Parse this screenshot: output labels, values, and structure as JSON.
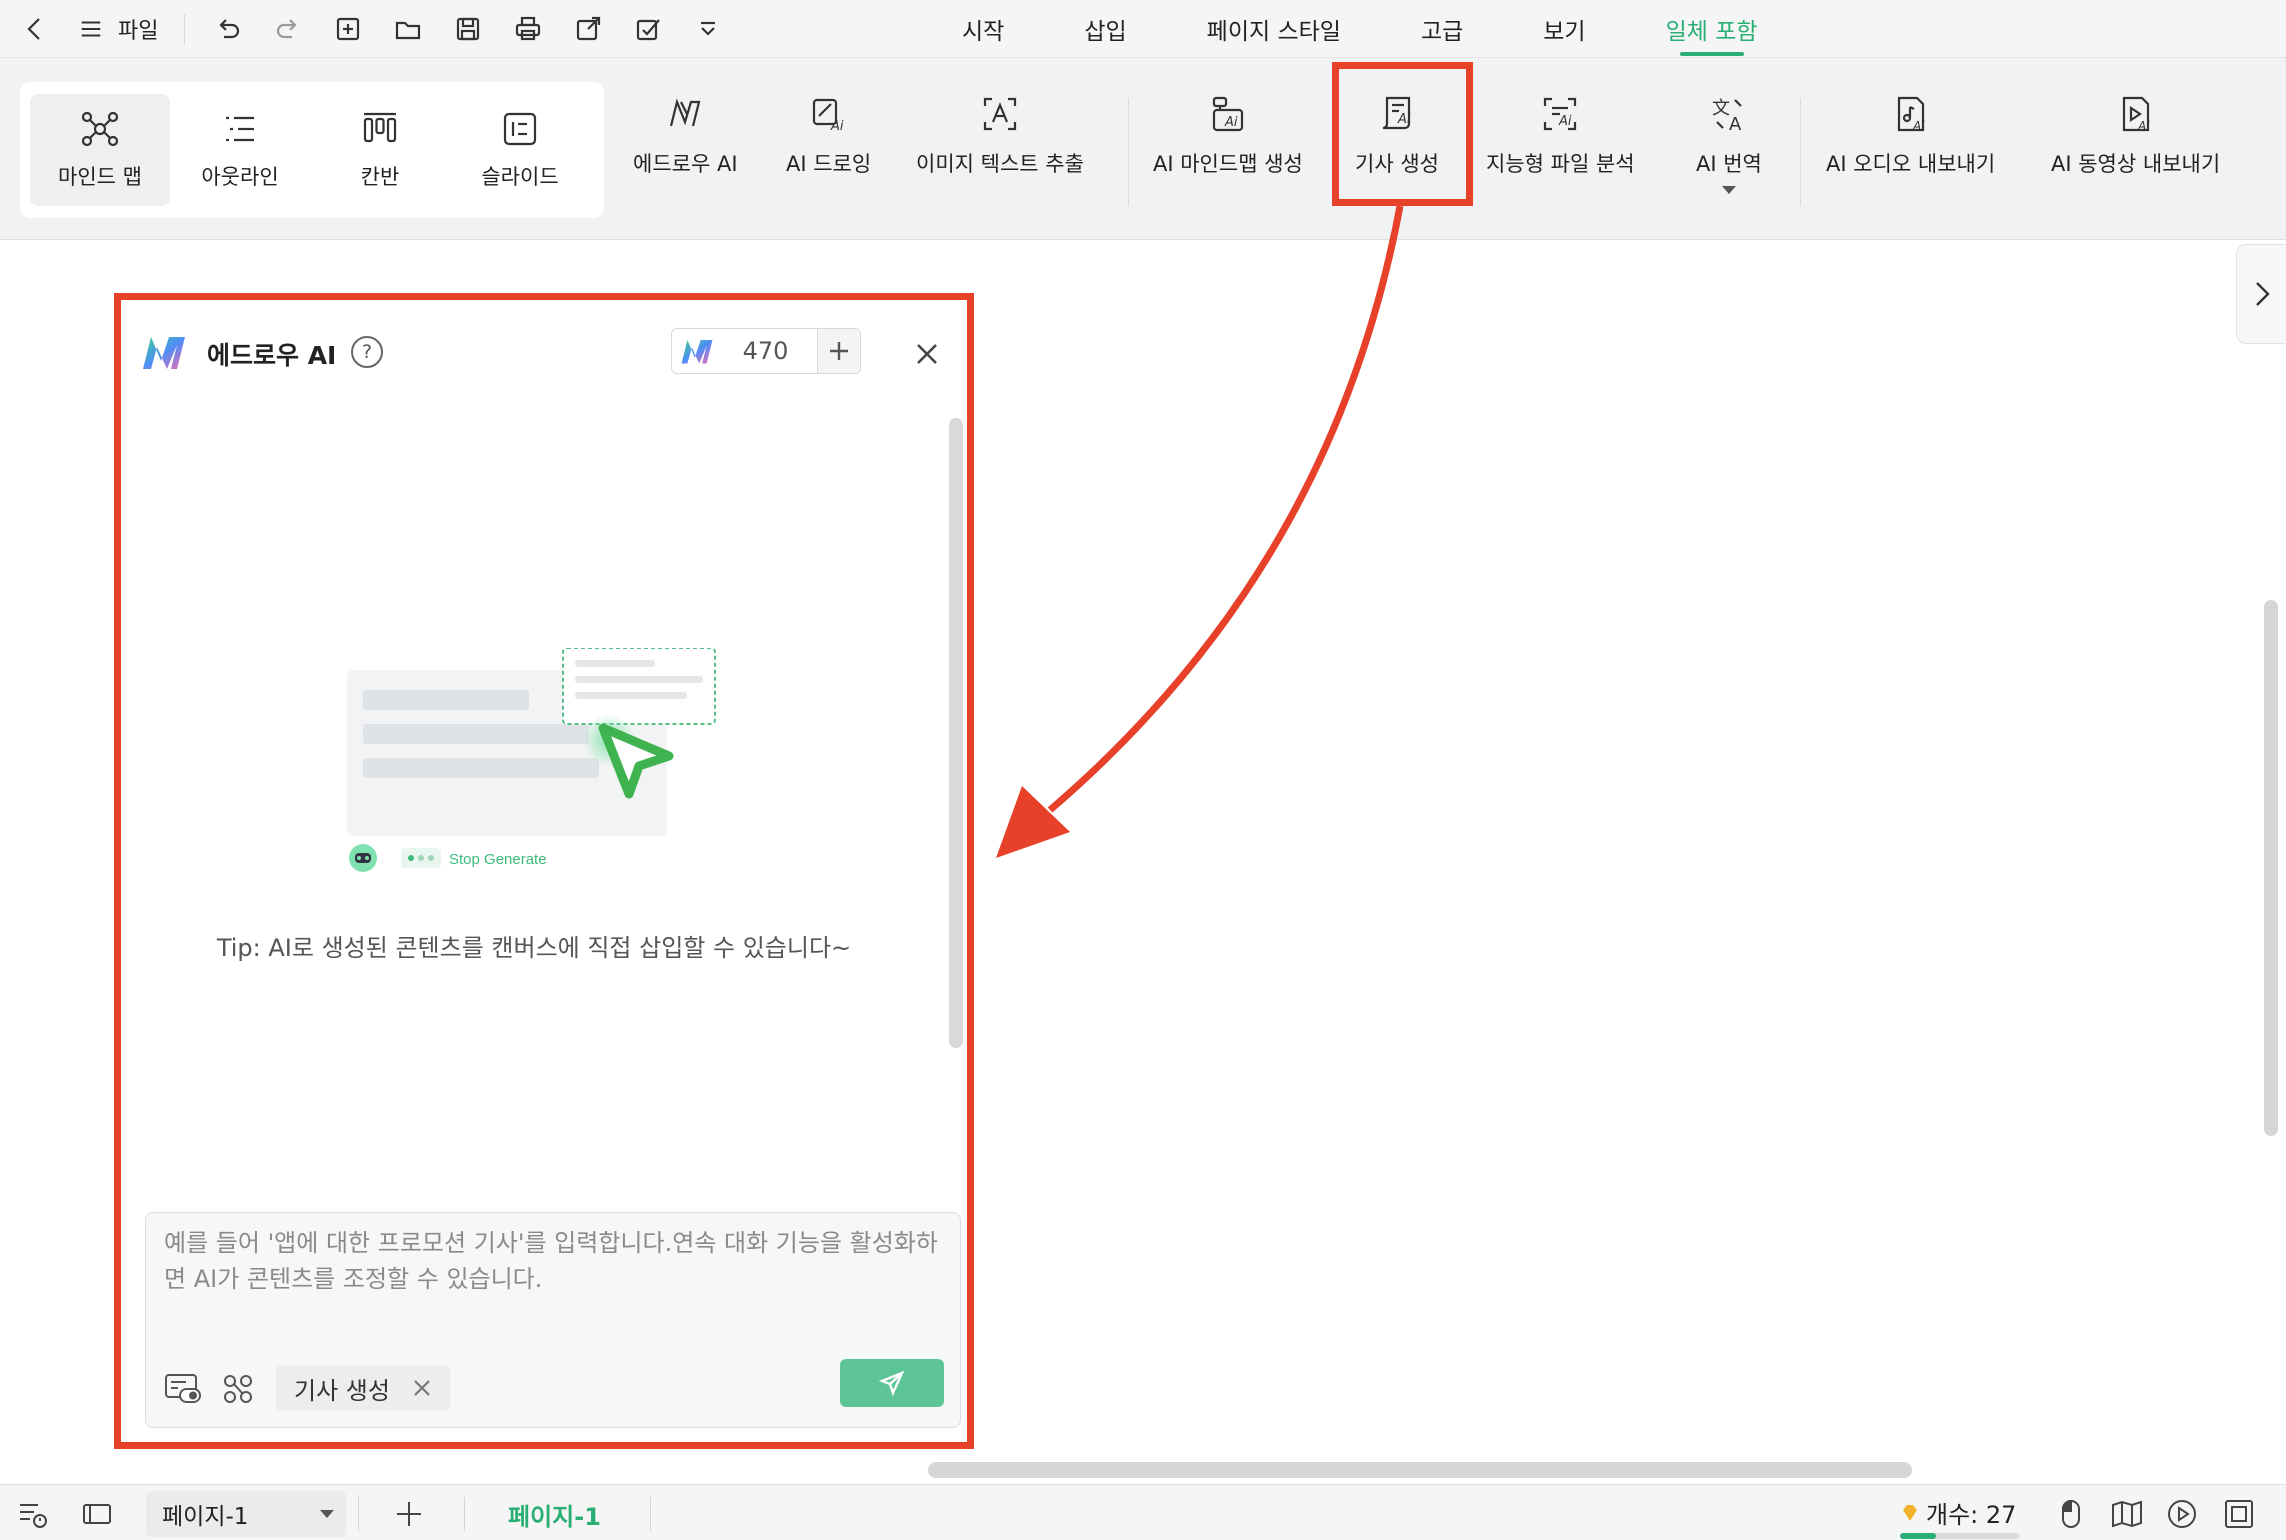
{
  "topbar": {
    "file_label": "파일",
    "tabs": [
      "시작",
      "삽입",
      "페이지 스타일",
      "고급",
      "보기",
      "일체 포함"
    ],
    "active_tab": "일체 포함"
  },
  "ribbon": {
    "views": [
      "마인드 맵",
      "아웃라인",
      "칸반",
      "슬라이드"
    ],
    "selected_view": "마인드 맵",
    "buttons": [
      "에드로우 AI",
      "AI 드로잉",
      "이미지 텍스트 추출",
      "AI 마인드맵 생성",
      "기사 생성",
      "지능형 파일 분석",
      "AI 번역",
      "AI 오디오 내보내기",
      "AI 동영상 내보내기"
    ],
    "highlighted_button": "기사 생성"
  },
  "panel": {
    "title": "에드로우 AI",
    "help": "?",
    "credits": "470",
    "illustration_label": "Stop Generate",
    "tip": "Tip: AI로 생성된 콘텐츠를 캔버스에 직접 삽입할 수 있습니다~",
    "input_placeholder": "예를 들어 '앱에 대한 프로모션 기사'를 입력합니다.연속 대화 기능을 활성화하면 AI가 콘텐츠를 조정할 수 있습니다.",
    "chip_label": "기사 생성"
  },
  "statusbar": {
    "page_select": "페이지-1",
    "page_tab": "페이지-1",
    "count_label": "개수: 27"
  },
  "colors": {
    "accent": "#2aae74",
    "annotation": "#e8412a",
    "send_button": "#5dc495"
  }
}
